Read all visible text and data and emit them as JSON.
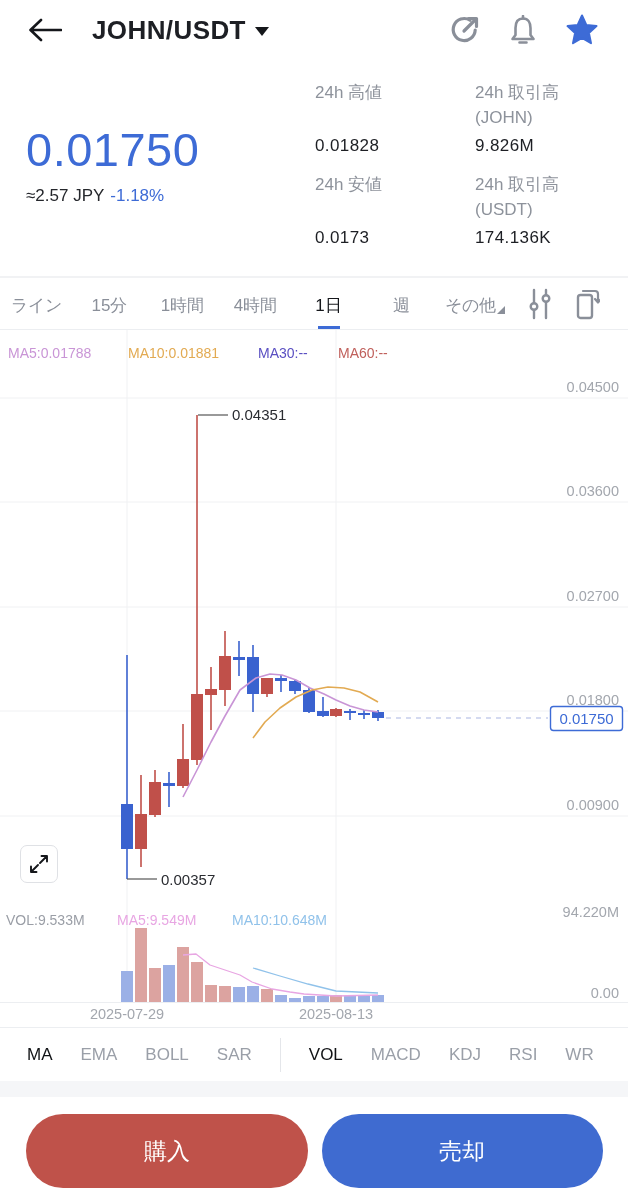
{
  "header": {
    "title": "JOHN/USDT",
    "favorite": true
  },
  "ticker": {
    "price": "0.01750",
    "fiat": "≈2.57 JPY",
    "change": "-1.18%",
    "stats": [
      {
        "label": "24h 高値",
        "value": "0.01828"
      },
      {
        "label": "24h 取引高 (JOHN)",
        "value": "9.826M"
      },
      {
        "label": "24h 安値",
        "value": "0.0173"
      },
      {
        "label": "24h 取引高 (USDT)",
        "value": "174.136K"
      }
    ]
  },
  "timeframe_tabs": [
    {
      "label": "ライン",
      "selected": false,
      "kind": "period"
    },
    {
      "label": "15分",
      "selected": false,
      "kind": "period"
    },
    {
      "label": "1時間",
      "selected": false,
      "kind": "period"
    },
    {
      "label": "4時間",
      "selected": false,
      "kind": "period"
    },
    {
      "label": "1日",
      "selected": true,
      "kind": "period"
    },
    {
      "label": "週",
      "selected": false,
      "kind": "period"
    },
    {
      "label": "その他",
      "selected": false,
      "kind": "menu"
    }
  ],
  "chart": {
    "ma_legend": [
      {
        "label": "MA5:0.01788",
        "color": "#c995d6"
      },
      {
        "label": "MA10:0.01881",
        "color": "#e2aa52"
      },
      {
        "label": "MA30:--",
        "color": "#5a4fc2"
      },
      {
        "label": "MA60:--",
        "color": "#c0605c"
      }
    ],
    "price_axis": [
      "0.04500",
      "0.03600",
      "0.02700",
      "0.01800",
      "0.00900"
    ],
    "high_label": "0.04351",
    "low_label": "0.00357",
    "last_price": "0.01750",
    "volume_legend": [
      {
        "label": "VOL:9.533M",
        "color": "#9a9ea6"
      },
      {
        "label": "MA5:9.549M",
        "color": "#e8a6e3"
      },
      {
        "label": "MA10:10.648M",
        "color": "#90c2ea"
      }
    ],
    "volume_axis": [
      "94.220M",
      "0.00"
    ],
    "dates": [
      "2025-07-29",
      "2025-08-13"
    ]
  },
  "indicators": {
    "main": [
      {
        "label": "MA",
        "selected": true
      },
      {
        "label": "EMA",
        "selected": false
      },
      {
        "label": "BOLL",
        "selected": false
      },
      {
        "label": "SAR",
        "selected": false
      }
    ],
    "sub": [
      {
        "label": "VOL",
        "selected": true
      },
      {
        "label": "MACD",
        "selected": false
      },
      {
        "label": "KDJ",
        "selected": false
      },
      {
        "label": "RSI",
        "selected": false
      },
      {
        "label": "WR",
        "selected": false
      }
    ]
  },
  "actions": [
    {
      "label": "購入",
      "kind": "buy"
    },
    {
      "label": "売却",
      "kind": "sell"
    }
  ]
}
